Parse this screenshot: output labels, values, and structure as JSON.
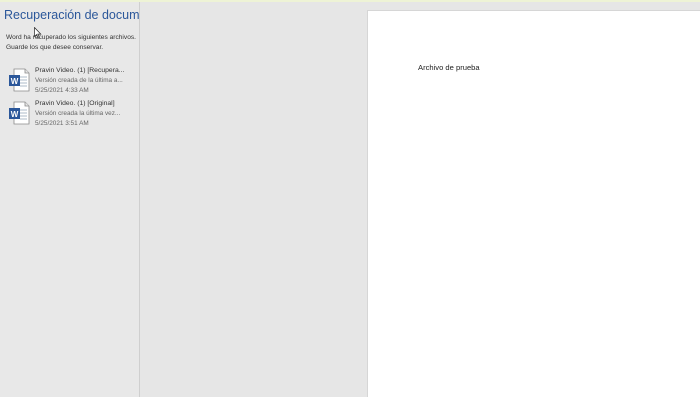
{
  "recovery_pane": {
    "title": "Recuperación de docume...",
    "description_line1": "Word ha recuperado los siguientes archivos.",
    "description_line2": "Guarde los que desee conservar.",
    "files": [
      {
        "name": "Pravin Video. (1)  [Recupera...",
        "description": "Versión creada de la última a...",
        "date": "5/25/2021 4:33 AM",
        "icon": "word-document-icon"
      },
      {
        "name": "Pravin Video. (1)  [Original]",
        "description": "Versión creada la última vez...",
        "date": "5/25/2021 3:51 AM",
        "icon": "word-document-icon"
      }
    ]
  },
  "document": {
    "body_text": "Archivo de prueba"
  },
  "colors": {
    "title_blue": "#2b579a",
    "word_blue": "#2b579a",
    "pane_bg": "#e8e8e8",
    "page_bg": "#ffffff"
  }
}
